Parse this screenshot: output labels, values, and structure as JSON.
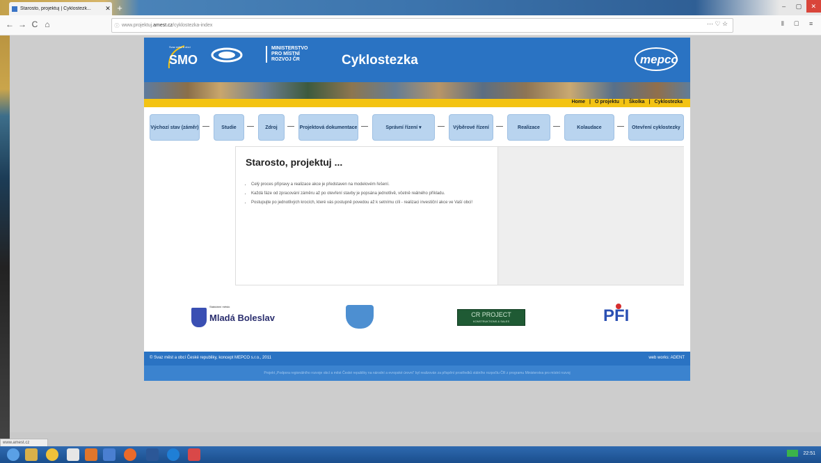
{
  "browser": {
    "tab_title": "Starosto, projektuj | Cyklostezk...",
    "tab_close": "✕",
    "new_tab": "+",
    "back": "←",
    "forward": "→",
    "reload": "C",
    "home": "⌂",
    "url_prefix": "www.projektuj.",
    "url_domain": "amest.cz",
    "url_suffix": "/cyklostezka-index",
    "url_menu": "··· ♡ ☆",
    "toolbar_icons": "⫴ ▢ ≡",
    "status_url": "www.amest.cz"
  },
  "site": {
    "smo_logo": "SMO",
    "smo_subtitle": "Svaz měst a obcí",
    "ministry_line1": "MINISTERSTVO",
    "ministry_line2": "PRO MÍSTNÍ",
    "ministry_line3": "ROZVOJ ČR",
    "title": "Cyklostezka",
    "mepco_logo": "mepco",
    "toplinks": [
      "Home",
      "|",
      "O projektu",
      "|",
      "Školka",
      "|",
      "Cyklostezka"
    ],
    "steps": [
      "Výchozí stav (záměr)",
      "Studie",
      "Zdroj",
      "Projektová dokumentace",
      "Správní řízení ▾",
      "Výběrové řízení",
      "Realizace",
      "Kolaudace",
      "Otevření cyklostezky"
    ],
    "heading": "Starosto, projektuj ...",
    "bullets": [
      "Celý proces přípravy a realizace akce je představen na modelovém řešení.",
      "Každá fáze od zpracování záměru až po otevření stavby je popsána jednotlivě, včetně reálného příkladu.",
      "Postupujte po jednotlivých krocích, které vás postupně povedou až k setnímu cíli - realizaci investiční akce ve Vaší obci!"
    ],
    "partner_mb_small": "Statutární město",
    "partner_mb": "Mladá Boleslav",
    "partner_cr": "CR PROJECT",
    "partner_cr_sub": "KONSTRUKTIONS & SALES",
    "partner_pfi": "PFI",
    "footer_left": "© Svaz měst a obcí České republiky, koncept MEPCO s.r.o., 2011",
    "footer_right": "web works: ADENT",
    "footer_note": "Projekt „Podpora regionálního rozvoje obcí a měst České republiky na národní a evropské úrovni“ byl realizován za přispění prostředků státního rozpočtu ČR z programu Ministerstva pro místní rozvoj"
  },
  "taskbar": {
    "tray_time": "22:51"
  },
  "colors": {
    "brand_blue": "#2a73c3",
    "accent_yellow": "#f3c313",
    "step_bg": "#b9d4ef"
  }
}
